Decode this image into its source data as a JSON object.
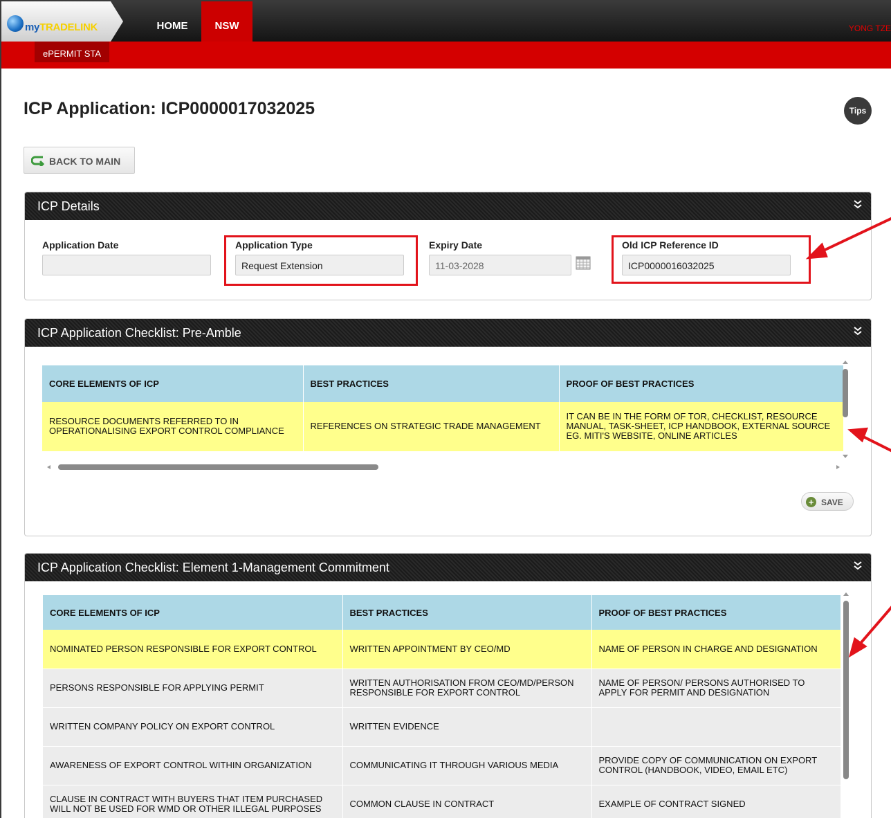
{
  "header": {
    "logo": {
      "my": "my",
      "brand": "TRADELINK"
    },
    "nav": [
      {
        "label": "HOME"
      },
      {
        "label": "NSW"
      }
    ],
    "user": "YONG TZE",
    "subtab": "ePERMIT STA"
  },
  "page": {
    "title": "ICP Application: ICP0000017032025",
    "tips": "Tips",
    "back_label": "BACK TO MAIN"
  },
  "details": {
    "title": "ICP Details",
    "fields": [
      {
        "label": "Application Date",
        "value": ""
      },
      {
        "label": "Application Type",
        "value": "Request Extension"
      },
      {
        "label": "Expiry Date",
        "value": "11-03-2028"
      },
      {
        "label": "Old ICP Reference ID",
        "value": "ICP0000016032025"
      }
    ]
  },
  "preamble": {
    "title": "ICP Application Checklist: Pre-Amble",
    "headers": [
      "CORE ELEMENTS OF ICP",
      "BEST PRACTICES",
      "PROOF OF BEST PRACTICES"
    ],
    "rows": [
      [
        "RESOURCE DOCUMENTS REFERRED TO IN OPERATIONALISING EXPORT CONTROL COMPLIANCE",
        "REFERENCES ON STRATEGIC TRADE MANAGEMENT",
        "IT CAN BE IN THE FORM OF TOR, CHECKLIST, RESOURCE MANUAL, TASK-SHEET, ICP HANDBOOK, EXTERNAL SOURCE EG. MITI'S WEBSITE, ONLINE ARTICLES"
      ]
    ],
    "save_label": "SAVE"
  },
  "element1": {
    "title": "ICP Application Checklist: Element 1-Management Commitment",
    "headers": [
      "CORE ELEMENTS OF ICP",
      "BEST PRACTICES",
      "PROOF OF BEST PRACTICES"
    ],
    "rows": [
      [
        "NOMINATED PERSON RESPONSIBLE FOR EXPORT CONTROL",
        "WRITTEN APPOINTMENT BY CEO/MD",
        "NAME OF PERSON IN CHARGE AND DESIGNATION"
      ],
      [
        "PERSONS RESPONSIBLE FOR APPLYING PERMIT",
        "WRITTEN AUTHORISATION FROM CEO/MD/PERSON RESPONSIBLE FOR EXPORT CONTROL",
        "NAME OF PERSON/ PERSONS AUTHORISED TO APPLY FOR PERMIT AND DESIGNATION"
      ],
      [
        "WRITTEN COMPANY POLICY ON EXPORT CONTROL",
        "WRITTEN EVIDENCE",
        ""
      ],
      [
        "AWARENESS OF EXPORT CONTROL WITHIN ORGANIZATION",
        "COMMUNICATING IT THROUGH VARIOUS MEDIA",
        "PROVIDE COPY OF COMMUNICATION ON EXPORT CONTROL (HANDBOOK, VIDEO, EMAIL ETC)"
      ],
      [
        "CLAUSE IN CONTRACT WITH BUYERS THAT ITEM PURCHASED WILL NOT BE USED FOR WMD OR OTHER ILLEGAL PURPOSES",
        "COMMON CLAUSE IN CONTRACT",
        "EXAMPLE OF CONTRACT SIGNED"
      ]
    ]
  },
  "colors": {
    "nav_red": "#cc0000",
    "subbar_red": "#d40000",
    "annotation_red": "#e2131b",
    "header_blue": "#add8e6",
    "highlight_yellow": "#ffff8c"
  }
}
